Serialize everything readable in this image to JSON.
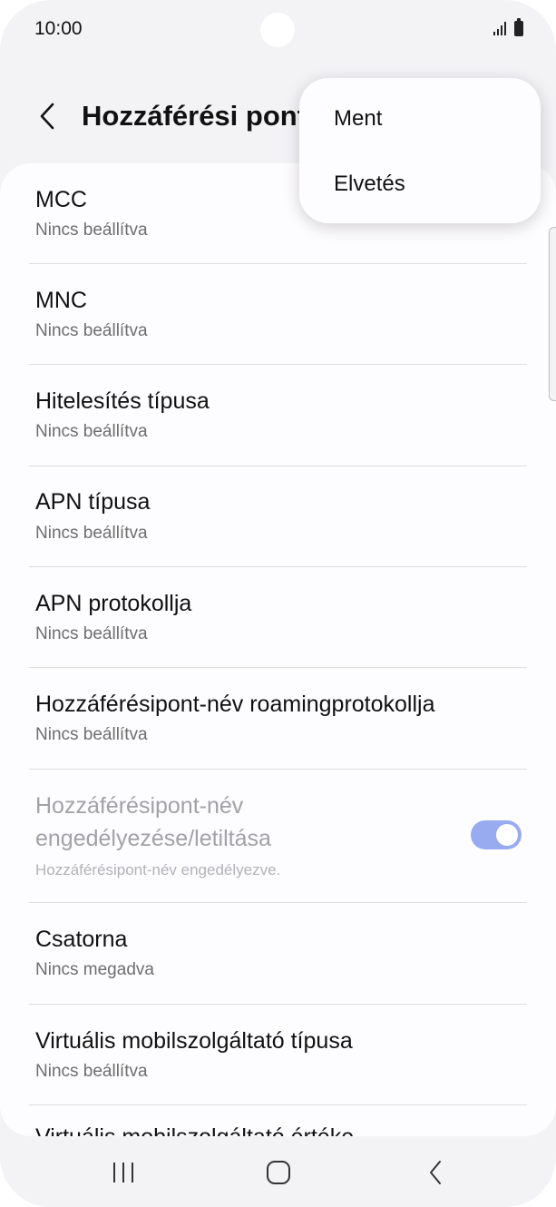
{
  "status_bar": {
    "time": "10:00"
  },
  "header": {
    "title": "Hozzáférési pont"
  },
  "menu": {
    "items": [
      "Ment",
      "Elvetés"
    ]
  },
  "settings": [
    {
      "title": "MCC",
      "subtitle": "Nincs beállítva"
    },
    {
      "title": "MNC",
      "subtitle": "Nincs beállítva"
    },
    {
      "title": "Hitelesítés típusa",
      "subtitle": "Nincs beállítva"
    },
    {
      "title": "APN típusa",
      "subtitle": "Nincs beállítva"
    },
    {
      "title": "APN protokollja",
      "subtitle": "Nincs beállítva"
    },
    {
      "title": "Hozzáférésipont-név roamingprotokollja",
      "subtitle": "Nincs beállítva"
    },
    {
      "title_line1": "Hozzáférésipont-név",
      "title_line2": "engedélyezése/letiltása",
      "subtitle": "Hozzáférésipont-név engedélyezve.",
      "enabled": true,
      "toggle_on": true
    },
    {
      "title": "Csatorna",
      "subtitle": "Nincs megadva"
    },
    {
      "title": "Virtuális mobilszolgáltató típusa",
      "subtitle": "Nincs beállítva"
    },
    {
      "title": "Virtuális mobilszolgáltató értéke"
    }
  ],
  "colors": {
    "toggle_accent": "#98abf0",
    "background": "#f3f3f6",
    "card": "#fdfcfe"
  }
}
